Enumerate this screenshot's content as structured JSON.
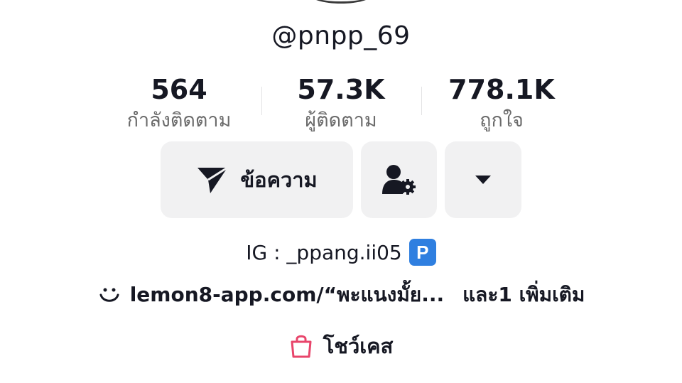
{
  "profile": {
    "username": "@pnpp_69"
  },
  "stats": {
    "following": {
      "value": "564",
      "label": "กำลังติดตาม"
    },
    "followers": {
      "value": "57.3K",
      "label": "ผู้ติดตาม"
    },
    "likes": {
      "value": "778.1K",
      "label": "ถูกใจ"
    }
  },
  "actions": {
    "message_label": "ข้อความ",
    "message_icon": "send-icon",
    "friend_icon": "user-settings-icon",
    "more_icon": "caret-down-icon"
  },
  "bio": {
    "ig_text": "IG : _ppang.ii05",
    "badge": "P",
    "link_text": "lemon8-app.com/“พะแนงมั้ย...",
    "link_more": "และ1 เพิ่มเติม"
  },
  "showcase": {
    "label": "โชว์เคส",
    "icon": "shopping-bag-icon",
    "icon_color": "#e8456b"
  },
  "colors": {
    "primary_text": "#161823",
    "secondary_text": "#6b6b6b",
    "button_bg": "#f1f1f2",
    "badge_blue": "#2f7fe0"
  }
}
